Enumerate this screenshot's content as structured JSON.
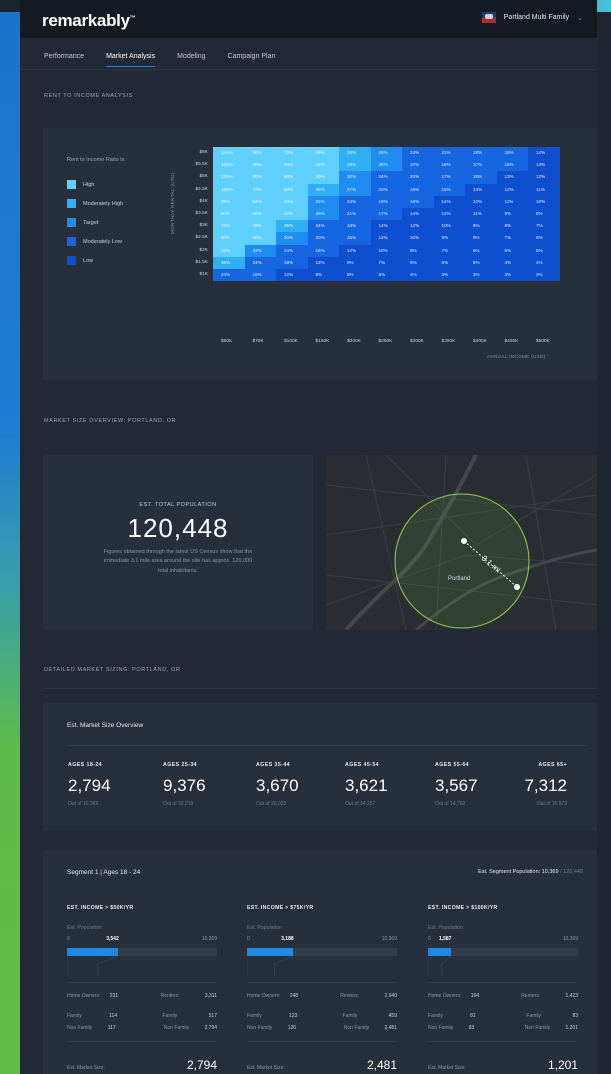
{
  "app": {
    "logo": "remarkably",
    "account_name": "Portland Multi Family"
  },
  "nav": {
    "tabs": [
      "Performance",
      "Market Analysis",
      "Modeling",
      "Campaign Plan"
    ],
    "active": "Market Analysis"
  },
  "rent_income": {
    "section_title": "RENT TO INCOME ANALYSIS",
    "legend_title": "Rent to Income Ratio is:",
    "legend": [
      {
        "label": "High",
        "color": "#5fd0ff"
      },
      {
        "label": "Moderately High",
        "color": "#2fb0f5"
      },
      {
        "label": "Target",
        "color": "#1e8cf0"
      },
      {
        "label": "Moderately Low",
        "color": "#1566e0"
      },
      {
        "label": "Low",
        "color": "#0e4fd0"
      }
    ],
    "y_axis_label": "MONTHLY RENTAL (USD)",
    "x_axis_label": "ANNUAL INCOME (USD)"
  },
  "chart_data": {
    "type": "heatmap",
    "rows": [
      "$6K",
      "$5.5K",
      "$5K",
      "$4.5K",
      "$4K",
      "$3.5K",
      "$3K",
      "$2.5K",
      "$2K",
      "$1.5K",
      "$1K"
    ],
    "columns": [
      "$50K",
      "$75K",
      "$100K",
      "$150K",
      "$200K",
      "$250K",
      "$300K",
      "$350K",
      "$400K",
      "$450K",
      "$500K"
    ],
    "values": [
      [
        "144%",
        "96%",
        "72%",
        "48%",
        "36%",
        "29%",
        "24%",
        "21%",
        "18%",
        "16%",
        "14%"
      ],
      [
        "132%",
        "88%",
        "66%",
        "44%",
        "33%",
        "26%",
        "22%",
        "19%",
        "17%",
        "15%",
        "13%"
      ],
      [
        "120%",
        "80%",
        "60%",
        "40%",
        "30%",
        "24%",
        "20%",
        "17%",
        "15%",
        "13%",
        "12%"
      ],
      [
        "108%",
        "72%",
        "54%",
        "36%",
        "27%",
        "22%",
        "18%",
        "15%",
        "14%",
        "12%",
        "11%"
      ],
      [
        "96%",
        "64%",
        "48%",
        "32%",
        "24%",
        "19%",
        "16%",
        "14%",
        "12%",
        "11%",
        "10%"
      ],
      [
        "84%",
        "56%",
        "42%",
        "28%",
        "21%",
        "17%",
        "14%",
        "12%",
        "11%",
        "9%",
        "8%"
      ],
      [
        "72%",
        "48%",
        "36%",
        "24%",
        "18%",
        "14%",
        "12%",
        "10%",
        "9%",
        "8%",
        "7%"
      ],
      [
        "60%",
        "40%",
        "30%",
        "20%",
        "15%",
        "12%",
        "10%",
        "9%",
        "8%",
        "7%",
        "6%"
      ],
      [
        "48%",
        "32%",
        "24%",
        "16%",
        "12%",
        "10%",
        "8%",
        "7%",
        "6%",
        "5%",
        "5%"
      ],
      [
        "36%",
        "24%",
        "18%",
        "12%",
        "9%",
        "7%",
        "6%",
        "5%",
        "5%",
        "4%",
        "4%"
      ],
      [
        "24%",
        "16%",
        "12%",
        "8%",
        "6%",
        "5%",
        "4%",
        "3%",
        "3%",
        "3%",
        "2%"
      ]
    ],
    "xlabel": "ANNUAL INCOME (USD)",
    "ylabel": "MONTHLY RENTAL (USD)"
  },
  "market_size": {
    "section_title": "MARKET SIZE OVERVIEW: PORTLAND, OR",
    "pop_label": "EST. TOTAL POPULATION",
    "pop_value": "120,448",
    "pop_desc": "Figures obtained through the latest US Census show that the immediate 3.1 mile area around the site has approx. 120,000 total inhabitants.",
    "map": {
      "radius_label": "3.1 mi",
      "city_label": "Portland"
    }
  },
  "detailed": {
    "section_title": "DETAILED MARKET SIZING: PORTLAND, OR",
    "overview_title": "Est. Market Size Overview",
    "ages": [
      {
        "label": "AGES 18-24",
        "value": "2,794",
        "out_of": "Out of 10,369"
      },
      {
        "label": "AGES 25-34",
        "value": "9,376",
        "out_of": "Out of 32,219"
      },
      {
        "label": "AGES 35-44",
        "value": "3,670",
        "out_of": "Out of 20,033"
      },
      {
        "label": "AGES 45-54",
        "value": "3,621",
        "out_of": "Out of 14,257"
      },
      {
        "label": "AGES 55-64",
        "value": "3,567",
        "out_of": "Out of 14,792"
      },
      {
        "label": "AGES 65+",
        "value": "7,312",
        "out_of": "Out of 15,979"
      }
    ]
  },
  "segment": {
    "title": "Segment 1 | Ages 18 - 24",
    "pop_label": "Est. Segment Population:",
    "pop_value": "10,369",
    "pop_total": "/ 120,448",
    "columns": [
      {
        "head": "EST. INCOME > $50K/YR",
        "pop_label": "Est. Population",
        "zero": "0",
        "value": "3,542",
        "max": "10,369",
        "fraction": 0.3416,
        "home_owners_label": "Home Owners:",
        "home_owners": "231",
        "renters_label": "Renters:",
        "renters": "3,311",
        "family_label": "Family",
        "fam_owners": "114",
        "fam_renters": "517",
        "nonfamily_label": "Non Family",
        "nf_owners": "117",
        "nf_renters": "2,794",
        "market_label": "Est. Market Size:",
        "market_size": "2,794"
      },
      {
        "head": "EST. INCOME > $75K/YR",
        "pop_label": "Est. Population",
        "zero": "0",
        "value": "3,188",
        "max": "10,369",
        "fraction": 0.3075,
        "home_owners_label": "Home Owners:",
        "home_owners": "248",
        "renters_label": "Renters:",
        "renters": "2,940",
        "family_label": "Family",
        "fam_owners": "123",
        "fam_renters": "459",
        "nonfamily_label": "Non Family",
        "nf_owners": "126",
        "nf_renters": "2,481",
        "market_label": "Est. Market Size:",
        "market_size": "2,481"
      },
      {
        "head": "EST. INCOME > $100K/YR",
        "pop_label": "Est. Population",
        "zero": "0",
        "value": "1,587",
        "max": "10,369",
        "fraction": 0.153,
        "home_owners_label": "Home Owners:",
        "home_owners": "164",
        "renters_label": "Renters:",
        "renters": "1,423",
        "family_label": "Family",
        "fam_owners": "81",
        "fam_renters": "83",
        "nonfamily_label": "Non Family",
        "nf_owners": "83",
        "nf_renters": "1,201",
        "market_label": "Est. Market Size:",
        "market_size": "1,201"
      }
    ]
  }
}
